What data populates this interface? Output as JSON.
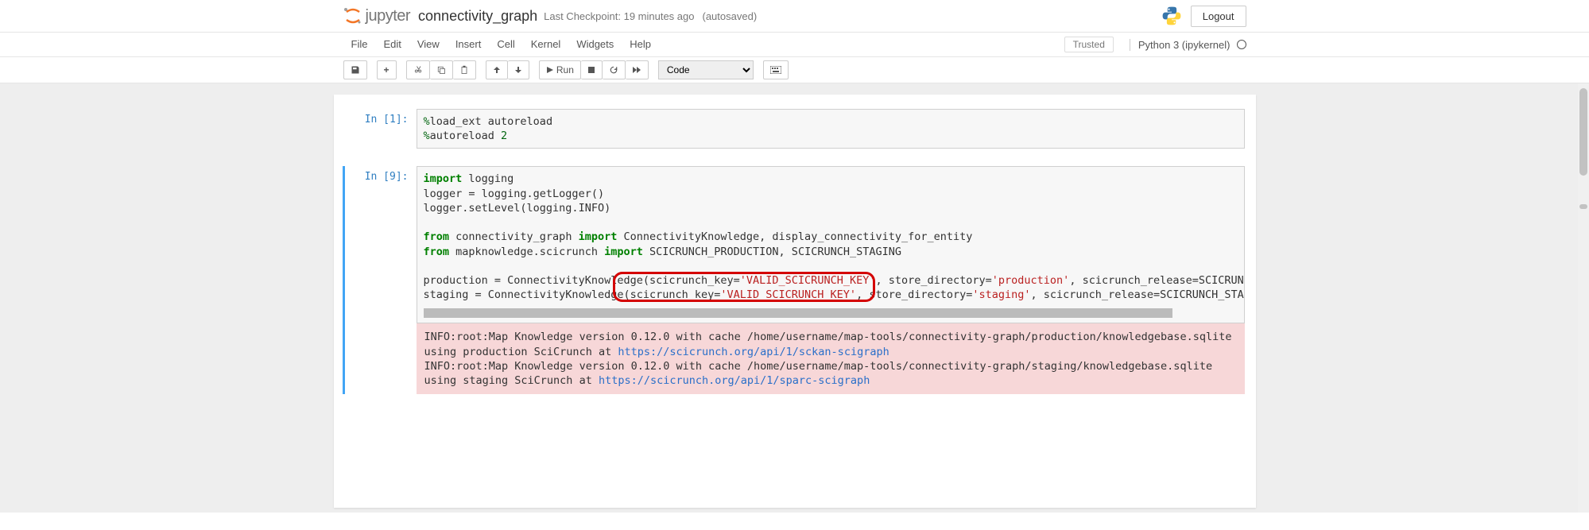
{
  "header": {
    "app_name": "jupyter",
    "notebook_name": "connectivity_graph",
    "checkpoint_prefix": "Last Checkpoint:",
    "checkpoint_time": "19 minutes ago",
    "autosaved": "(autosaved)",
    "logout": "Logout"
  },
  "menubar": {
    "items": [
      "File",
      "Edit",
      "View",
      "Insert",
      "Cell",
      "Kernel",
      "Widgets",
      "Help"
    ],
    "trusted": "Trusted",
    "kernel": "Python 3 (ipykernel)"
  },
  "toolbar": {
    "run_label": "Run",
    "celltype": "Code"
  },
  "cells": [
    {
      "prompt": "In [1]:",
      "lines": [
        {
          "spans": [
            {
              "cls": "cm-magic",
              "t": "%"
            },
            {
              "cls": "cm-text",
              "t": "load_ext autoreload"
            }
          ]
        },
        {
          "spans": [
            {
              "cls": "cm-magic",
              "t": "%"
            },
            {
              "cls": "cm-text",
              "t": "autoreload "
            },
            {
              "cls": "cm-num",
              "t": "2"
            }
          ]
        }
      ]
    },
    {
      "prompt": "In [9]:",
      "lines": [
        {
          "spans": [
            {
              "cls": "cm-keyword",
              "t": "import"
            },
            {
              "cls": "cm-text",
              "t": " logging"
            }
          ]
        },
        {
          "spans": [
            {
              "cls": "cm-text",
              "t": "logger = logging.getLogger()"
            }
          ]
        },
        {
          "spans": [
            {
              "cls": "cm-text",
              "t": "logger.setLevel(logging.INFO)"
            }
          ]
        },
        {
          "spans": [
            {
              "cls": "cm-text",
              "t": ""
            }
          ]
        },
        {
          "spans": [
            {
              "cls": "cm-keyword",
              "t": "from"
            },
            {
              "cls": "cm-text",
              "t": " connectivity_graph "
            },
            {
              "cls": "cm-keyword",
              "t": "import"
            },
            {
              "cls": "cm-text",
              "t": " ConnectivityKnowledge, display_connectivity_for_entity"
            }
          ]
        },
        {
          "spans": [
            {
              "cls": "cm-keyword",
              "t": "from"
            },
            {
              "cls": "cm-text",
              "t": " mapknowledge.scicrunch "
            },
            {
              "cls": "cm-keyword",
              "t": "import"
            },
            {
              "cls": "cm-text",
              "t": " SCICRUNCH_PRODUCTION, SCICRUNCH_STAGING"
            }
          ]
        },
        {
          "spans": [
            {
              "cls": "cm-text",
              "t": ""
            }
          ]
        },
        {
          "spans": [
            {
              "cls": "cm-text",
              "t": "production = ConnectivityKnowl"
            },
            {
              "cls": "cm-text hl-start",
              "t": "edge(scicrunch_key="
            },
            {
              "cls": "cm-string",
              "t": "'VALID_SCICRUNCH_KEY'"
            },
            {
              "cls": "cm-text hl-end",
              "t": ","
            },
            {
              "cls": "cm-text",
              "t": " store_directory="
            },
            {
              "cls": "cm-string",
              "t": "'production'"
            },
            {
              "cls": "cm-text",
              "t": ", scicrunch_release=SCICRUNCH"
            }
          ]
        },
        {
          "spans": [
            {
              "cls": "cm-text",
              "t": "staging = ConnectivityKnowled"
            },
            {
              "cls": "cm-text",
              "t": "ge(scicrunch_key="
            },
            {
              "cls": "cm-string",
              "t": "'VALID_SCICRUNCH_KEY'"
            },
            {
              "cls": "cm-text",
              "t": ", st"
            },
            {
              "cls": "cm-text",
              "t": "ore_directory="
            },
            {
              "cls": "cm-string",
              "t": "'staging'"
            },
            {
              "cls": "cm-text",
              "t": ", scicrunch_release=SCICRUNCH_STAGI"
            }
          ]
        }
      ],
      "output_log": {
        "parts": [
          {
            "t": "INFO:root:Map Knowledge version 0.12.0 with cache /home/username/map-tools/connectivity-graph/production/knowledgebase.sqlite using production SciCrunch at "
          },
          {
            "href": "#",
            "t": "https://scicrunch.org/api/1/sckan-scigraph"
          },
          {
            "t": "\nINFO:root:Map Knowledge version 0.12.0 with cache /home/username/map-tools/connectivity-graph/staging/knowledgebase.sqlite using staging SciCrunch at "
          },
          {
            "href": "#",
            "t": "https://scicrunch.org/api/1/sparc-scigraph"
          }
        ]
      }
    }
  ],
  "annotations": {
    "highlight_row": 7,
    "highlight_text_a": "edge(scicrunch_key='VALID_SCICRUNCH_KEY',",
    "highlight_text_b": "ge(scicrunch_key='VALID_SCICRUNCH_KEY', st"
  }
}
